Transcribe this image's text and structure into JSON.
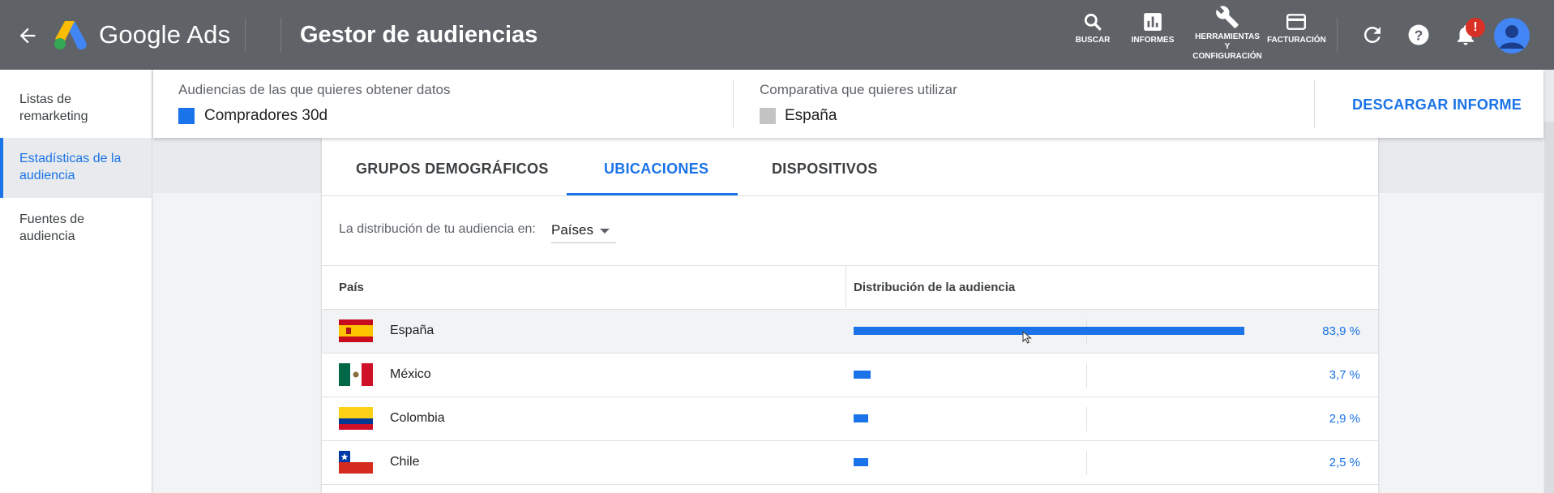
{
  "topbar": {
    "brand": "Google Ads",
    "page_title": "Gestor de audiencias",
    "tools": [
      {
        "icon": "search-icon",
        "label": "BUSCAR"
      },
      {
        "icon": "bar-chart-icon",
        "label": "INFORMES"
      },
      {
        "icon": "wrench-icon",
        "label": "HERRAMIENTAS Y CONFIGURACIÓN"
      },
      {
        "icon": "credit-card-icon",
        "label": "FACTURACIÓN"
      }
    ],
    "notification_badge": "!"
  },
  "sidebar": {
    "items": [
      {
        "label": "Listas de remarketing",
        "active": false
      },
      {
        "label": "Estadísticas de la audiencia",
        "active": true
      },
      {
        "label": "Fuentes de audiencia",
        "active": false
      }
    ]
  },
  "header": {
    "audience_label": "Audiencias de las que quieres obtener datos",
    "audience_value": "Compradores 30d",
    "audience_color": "#1a73e8",
    "comparison_label": "Comparativa que quieres utilizar",
    "comparison_value": "España",
    "comparison_color": "#c4c4c4",
    "download_label": "DESCARGAR INFORME"
  },
  "tabs": [
    {
      "label": "GRUPOS DEMOGRÁFICOS",
      "active": false
    },
    {
      "label": "UBICACIONES",
      "active": true
    },
    {
      "label": "DISPOSITIVOS",
      "active": false
    }
  ],
  "distribution": {
    "label": "La distribución de tu audiencia en:",
    "selected": "Países"
  },
  "table": {
    "headers": [
      "País",
      "Distribución de la audiencia"
    ],
    "rows": [
      {
        "country": "España",
        "flag": "spain-flag-icon",
        "value": 83.9,
        "label": "83,9 %"
      },
      {
        "country": "México",
        "flag": "mexico-flag-icon",
        "value": 3.7,
        "label": "3,7 %"
      },
      {
        "country": "Colombia",
        "flag": "colombia-flag-icon",
        "value": 2.9,
        "label": "2,9 %"
      },
      {
        "country": "Chile",
        "flag": "chile-flag-icon",
        "value": 2.5,
        "label": "2,5 %"
      }
    ]
  }
}
